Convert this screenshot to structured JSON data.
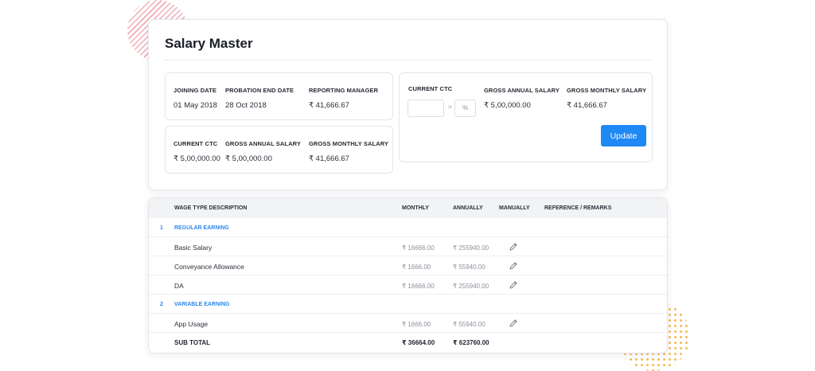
{
  "title": "Salary Master",
  "employee_info": {
    "joining_date": {
      "label": "JOINING DATE",
      "value": "01 May 2018"
    },
    "probation_end_date": {
      "label": "PROBATION END DATE",
      "value": "28 Oct 2018"
    },
    "reporting_manager": {
      "label": "REPORTING MANAGER",
      "value": "₹ 41,666.67"
    },
    "current_ctc": {
      "label": "CURRENT CTC",
      "value": "₹ 5,00,000.00"
    },
    "gross_annual_salary": {
      "label": "GROSS ANNUAL SALARY",
      "value": "₹ 5,00,000.00"
    },
    "gross_monthly_salary": {
      "label": "GROSS MONTHLY SALARY",
      "value": "₹ 41,666.67"
    }
  },
  "ctc_update": {
    "current_ctc_label": "CURRENT CTC",
    "ctc_input_value": "",
    "separator": ">",
    "percent_placeholder": "%",
    "gross_annual_label": "GROSS ANNUAL SALARY",
    "gross_annual_value": "₹ 5,00,000.00",
    "gross_monthly_label": "GROSS MONTHLY SALARY",
    "gross_monthly_value": "₹ 41,666.67",
    "update_label": "Update"
  },
  "table": {
    "headers": {
      "description": "WAGE TYPE DESCRIPTION",
      "monthly": "MONTHLY",
      "annually": "ANNUALLY",
      "manually": "MANUALLY",
      "remarks": "REFERENCE / REMARKS"
    },
    "sections": [
      {
        "num": "1",
        "name": "REGULAR EARNING",
        "rows": [
          {
            "desc": "Basic Salary",
            "monthly": "₹ 16666.00",
            "annually": "₹ 255940.00"
          },
          {
            "desc": "Conveyance Allowance",
            "monthly": "₹ 1666.00",
            "annually": "₹ 55940.00"
          },
          {
            "desc": "DA",
            "monthly": "₹ 16666.00",
            "annually": "₹ 255940.00"
          }
        ]
      },
      {
        "num": "2",
        "name": "VARIABLE EARNING",
        "rows": [
          {
            "desc": "App Usage",
            "monthly": "₹ 1666.00",
            "annually": "₹ 55940.00"
          }
        ]
      }
    ],
    "subtotal": {
      "label": "SUB TOTAL",
      "monthly": "₹ 36664.00",
      "annually": "₹ 623760.00"
    }
  },
  "colors": {
    "accent": "#1e88f5",
    "section": "#2f87e8",
    "deco_stripes": "#f2a3ad",
    "deco_dots": "#f5b54a"
  },
  "icons": {
    "edit": "pencil-icon"
  }
}
